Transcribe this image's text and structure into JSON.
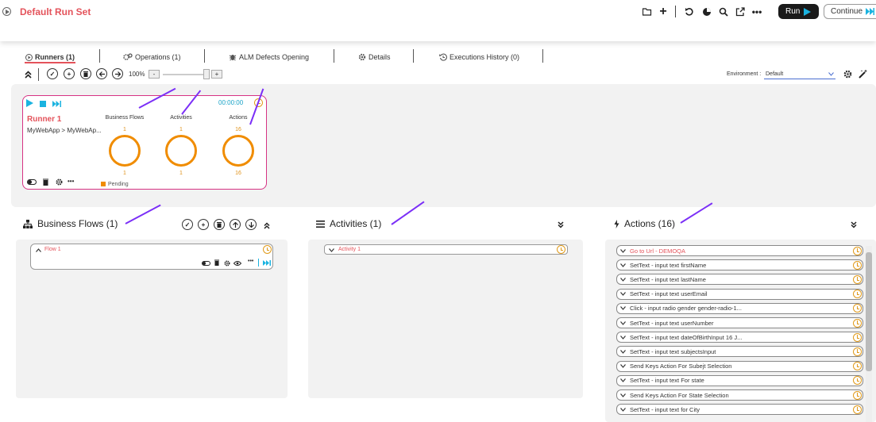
{
  "header": {
    "title": "Default Run Set",
    "run_label": "Run",
    "continue_label": "Continue"
  },
  "tabs": [
    {
      "label": "Runners (1)"
    },
    {
      "label": "Operations (1)"
    },
    {
      "label": "ALM Defects Opening"
    },
    {
      "label": "Details"
    },
    {
      "label": "Executions History (0)"
    }
  ],
  "toolbar": {
    "zoom": "100%",
    "zoom_minus": "-",
    "zoom_plus": "+",
    "environment_label": "Environment :",
    "environment_value": "Default"
  },
  "runner": {
    "name": "Runner 1",
    "path": "MyWebApp > MyWebAp...",
    "time": "00:00:00",
    "stats": [
      {
        "title": "Business Flows",
        "top": "1",
        "bottom": "1"
      },
      {
        "title": "Activities",
        "top": "1",
        "bottom": "1"
      },
      {
        "title": "Actions",
        "top": "16",
        "bottom": "16"
      }
    ],
    "status": "Pending"
  },
  "sections": {
    "business_flows": "Business Flows (1)",
    "activities": "Activities (1)",
    "actions": "Actions (16)"
  },
  "flow": {
    "name": "Flow 1"
  },
  "activity": {
    "name": "Activity 1"
  },
  "actions": [
    "Go to Url - DEMOQA",
    "SetText - input text firstName",
    "SetText - input text lastName",
    "SetText - input text userEmail",
    "Click - input radio gender gender-radio-1...",
    "SetText - input text userNumber",
    "SetText - input text dateOfBirthInput 16 J...",
    "SetText - input text subjectsInput",
    "Send Keys Action For Subejt Selection",
    "SetText - input text For state",
    "Send Keys Action For State Selection",
    "SetText - input text for City"
  ],
  "colors": {
    "accent": "#e4535b",
    "runner_border": "#d63384",
    "ring": "#f08c00",
    "arrow": "#7b2ff7",
    "time": "#1aa3c7"
  }
}
